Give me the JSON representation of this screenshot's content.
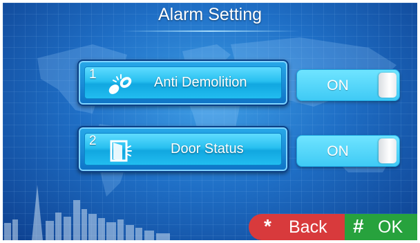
{
  "header": {
    "title": "Alarm Setting"
  },
  "items": [
    {
      "number": "1",
      "icon": "broken-chain-icon",
      "label": "Anti Demolition",
      "toggle": "ON"
    },
    {
      "number": "2",
      "icon": "door-sensor-icon",
      "label": "Door Status",
      "toggle": "ON"
    }
  ],
  "footer": {
    "back": {
      "symbol": "*",
      "label": "Back"
    },
    "ok": {
      "symbol": "#",
      "label": "OK"
    }
  },
  "colors": {
    "background": "#1f6fc6",
    "item": "#28c0f0",
    "toggle": "#5ad8fc",
    "back": "#d83a3c",
    "ok": "#27a23d"
  }
}
